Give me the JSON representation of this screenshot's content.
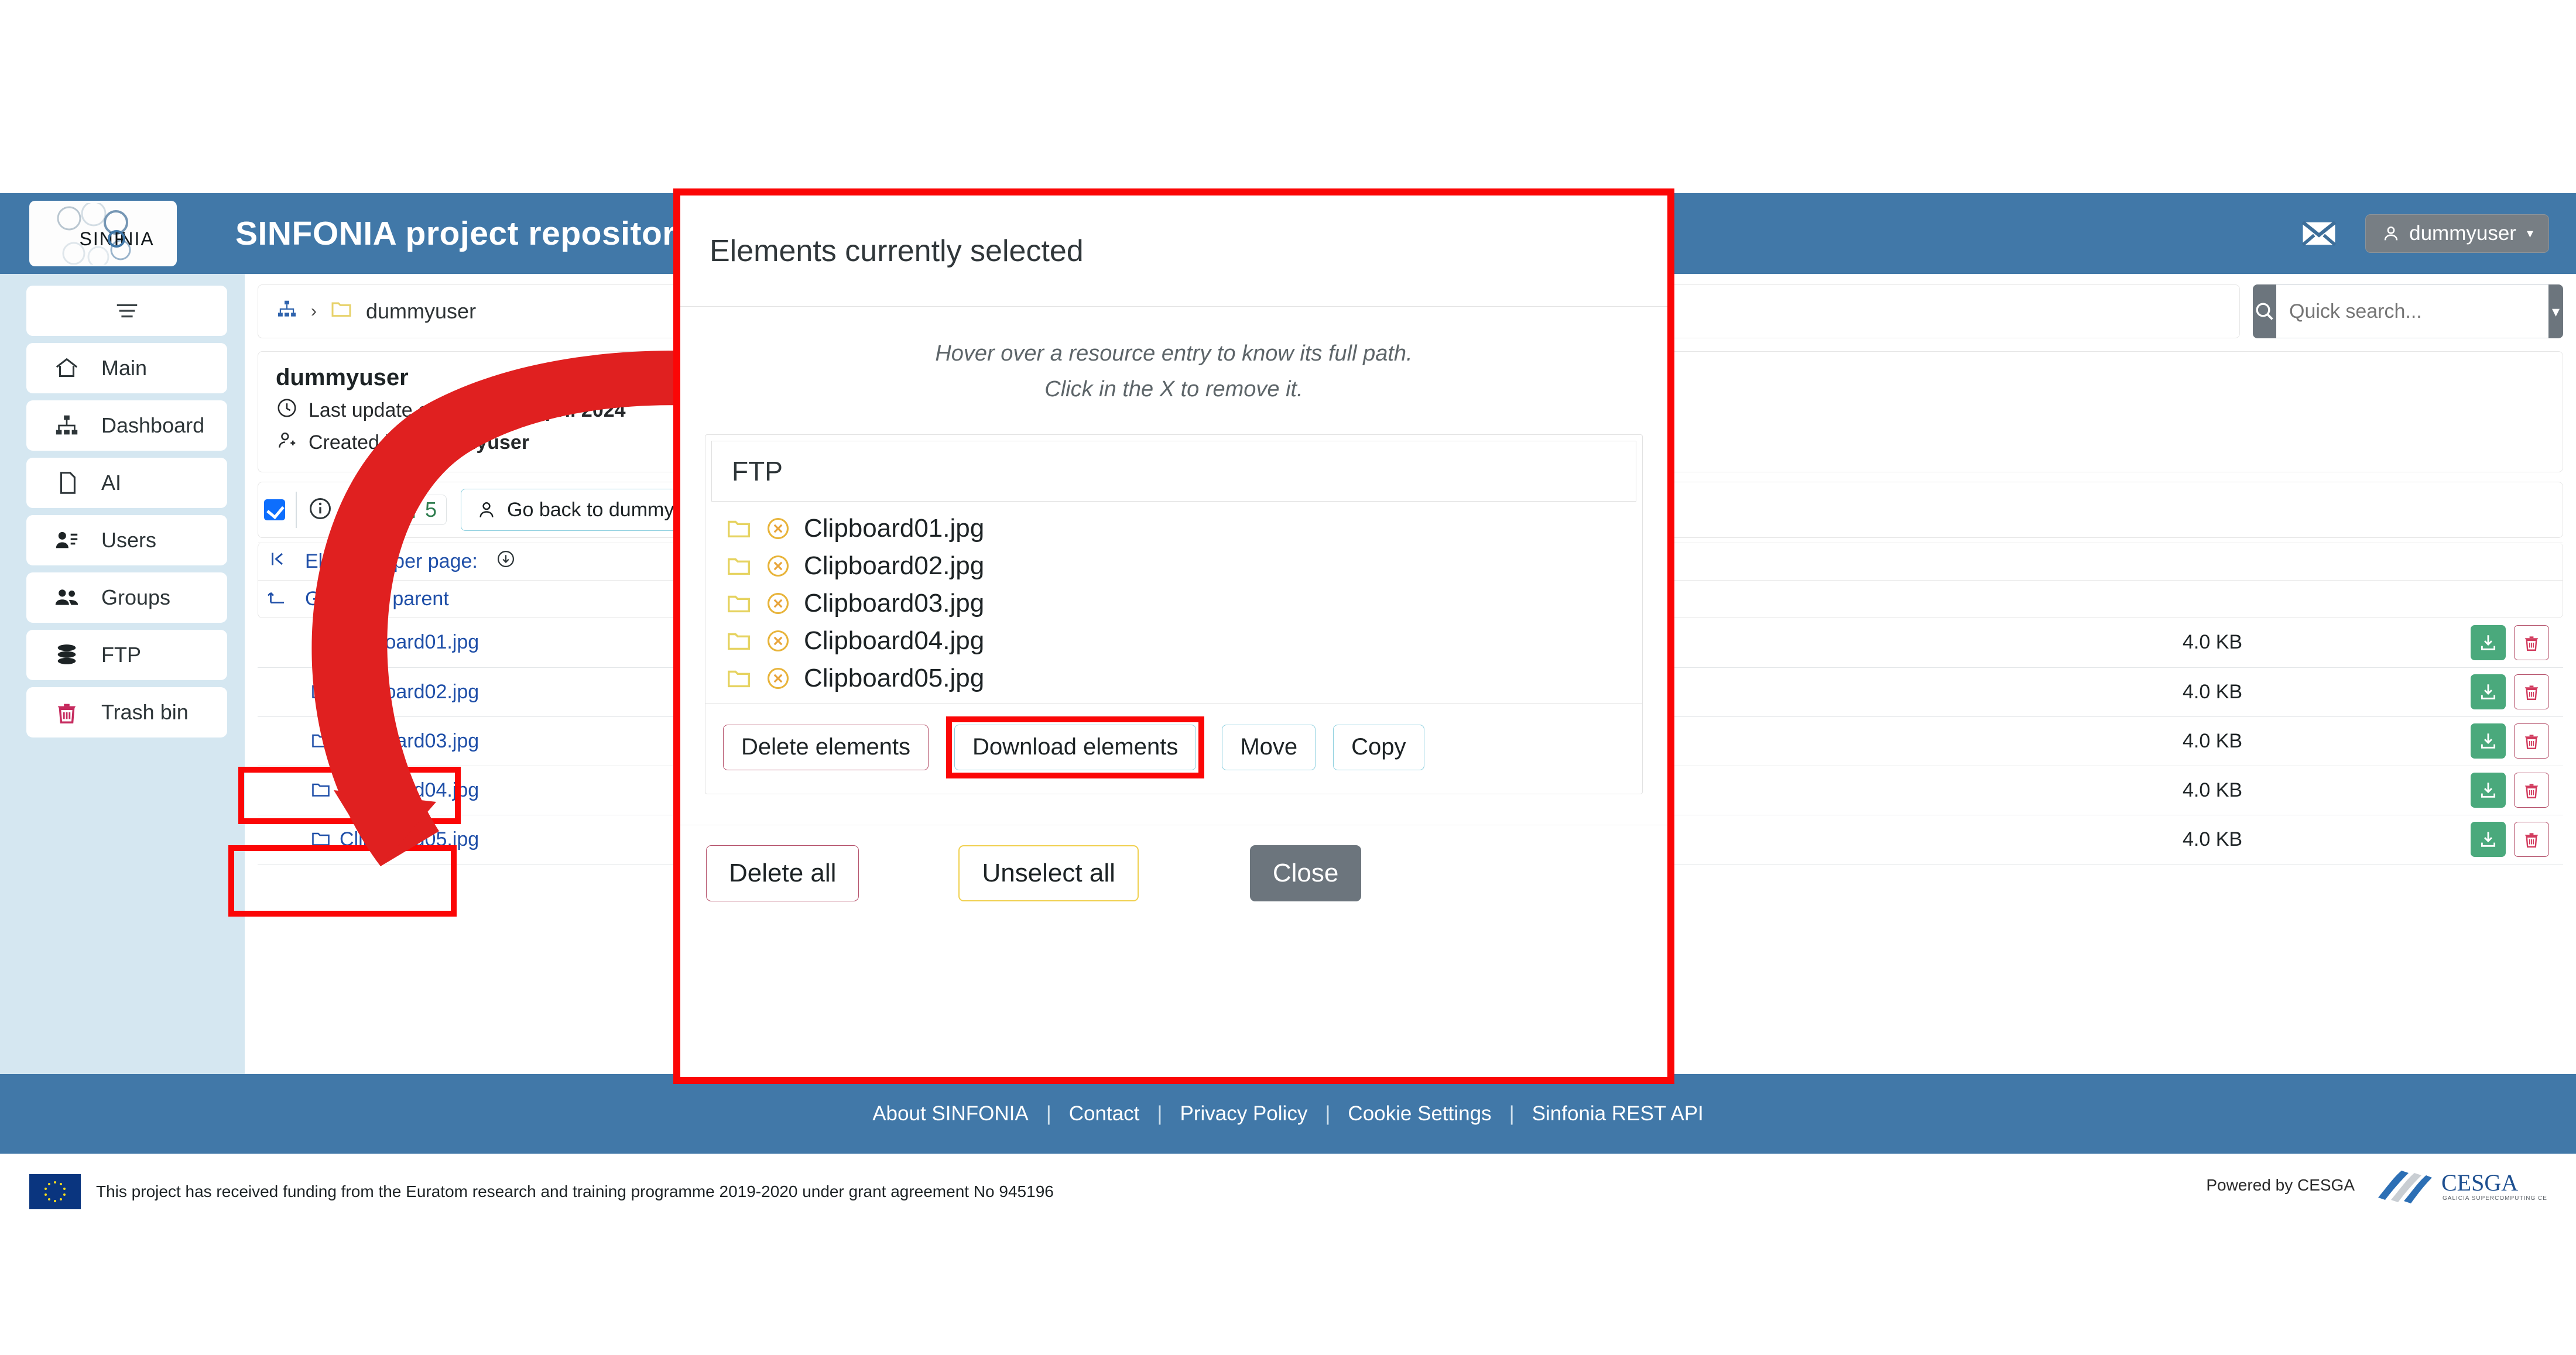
{
  "colors": {
    "brand_blue": "#4178a8",
    "sidebar_bg": "#d5e7f1",
    "annotation_red": "#fb0606",
    "link_blue": "#1f4fa8",
    "download_green": "#4aa97c",
    "delete_red": "#b5516b",
    "folder_yellow": "#e6d361",
    "close_grey": "#6c757d"
  },
  "navbar": {
    "logo_text": "SINFONIA",
    "title": "SINFONIA project repository",
    "mail_icon": "envelope-icon",
    "user_icon": "person-icon",
    "user_name": "dummyuser",
    "caret": "▾"
  },
  "sidebar": {
    "hamburger_icon": "hamburger-menu-icon",
    "items": [
      {
        "label": "Main",
        "icon": "home-icon"
      },
      {
        "label": "Dashboard",
        "icon": "sitemap-icon"
      },
      {
        "label": "AI",
        "icon": "file-icon"
      },
      {
        "label": "Users",
        "icon": "user-list-icon"
      },
      {
        "label": "Groups",
        "icon": "people-icon"
      },
      {
        "label": "FTP",
        "icon": "database-icon"
      },
      {
        "label": "Trash bin",
        "icon": "trash-icon"
      }
    ],
    "highlighted_item": "FTP"
  },
  "breadcrumb": {
    "root_icon": "sitemap-icon",
    "separator": "›",
    "folder_icon": "folder-icon",
    "current": "dummyuser"
  },
  "info": {
    "name": "dummyuser",
    "clock_icon": "clock-icon",
    "update_prefix": "Last update on ",
    "update_value": "Wed, 24 April 2024",
    "creator_icon": "user-plus-icon",
    "created_prefix": "Created by ",
    "created_value": "dummyuser"
  },
  "toolbar": {
    "select_all_checked": true,
    "info_icon": "info-circle-icon",
    "upload_icon": "upload-icon",
    "folder_icon": "folder-open-icon",
    "folder_count": "5",
    "goback_icon": "person-icon",
    "goback_label": "Go back to dummyuser"
  },
  "pagination": {
    "first_page_icon": "first-page-icon",
    "per_page_label": "Elements per page:",
    "per_page_dropdown_icon": "circle-down-icon"
  },
  "parent_row": {
    "icon": "arrow-up-left-icon",
    "label": "Go to the parent"
  },
  "search": {
    "icon": "search-icon",
    "placeholder": "Quick search...",
    "value": "",
    "dropdown_caret": "▾"
  },
  "files": {
    "rows": [
      {
        "checked": true,
        "icon": "folder-open-icon",
        "name": "Clipboard01.jpg",
        "size": "4.0 KB",
        "download_icon": "download-icon",
        "delete_icon": "trash-icon"
      },
      {
        "checked": true,
        "icon": "folder-open-icon",
        "name": "Clipboard02.jpg",
        "size": "4.0 KB",
        "download_icon": "download-icon",
        "delete_icon": "trash-icon"
      },
      {
        "checked": true,
        "icon": "folder-open-icon",
        "name": "Clipboard03.jpg",
        "size": "4.0 KB",
        "download_icon": "download-icon",
        "delete_icon": "trash-icon"
      },
      {
        "checked": true,
        "icon": "folder-open-icon",
        "name": "Clipboard04.jpg",
        "size": "4.0 KB",
        "download_icon": "download-icon",
        "delete_icon": "trash-icon"
      },
      {
        "checked": true,
        "icon": "folder-open-icon",
        "name": "Clipboard05.jpg",
        "size": "4.0 KB",
        "download_icon": "download-icon",
        "delete_icon": "trash-icon"
      }
    ]
  },
  "modal": {
    "title": "Elements currently selected",
    "note_line1": "Hover over a resource entry to know its full path.",
    "note_line2": "Click in the X to remove it.",
    "root_label": "FTP",
    "entries": [
      {
        "folder_icon": "folder-icon",
        "remove_icon": "circle-x-icon",
        "name": "Clipboard01.jpg"
      },
      {
        "folder_icon": "folder-icon",
        "remove_icon": "circle-x-icon",
        "name": "Clipboard02.jpg"
      },
      {
        "folder_icon": "folder-icon",
        "remove_icon": "circle-x-icon",
        "name": "Clipboard03.jpg"
      },
      {
        "folder_icon": "folder-icon",
        "remove_icon": "circle-x-icon",
        "name": "Clipboard04.jpg"
      },
      {
        "folder_icon": "folder-icon",
        "remove_icon": "circle-x-icon",
        "name": "Clipboard05.jpg"
      }
    ],
    "actions": {
      "delete_elements": "Delete elements",
      "download_elements": "Download elements",
      "move": "Move",
      "copy": "Copy",
      "highlighted": "Download elements"
    },
    "footer": {
      "delete_all": "Delete all",
      "unselect_all": "Unselect all",
      "close": "Close"
    }
  },
  "footer": {
    "links": [
      "About SINFONIA",
      "Contact",
      "Privacy Policy",
      "Cookie Settings",
      "Sinfonia REST API"
    ],
    "separator": "|",
    "funding_text": "This project has received funding from the Euratom research and training programme 2019-2020 under grant agreement No 945196",
    "powered_label": "Powered by CESGA",
    "cesga_name": "CESGA",
    "cesga_tagline": "GALICIA SUPERCOMPUTING CENTER"
  }
}
